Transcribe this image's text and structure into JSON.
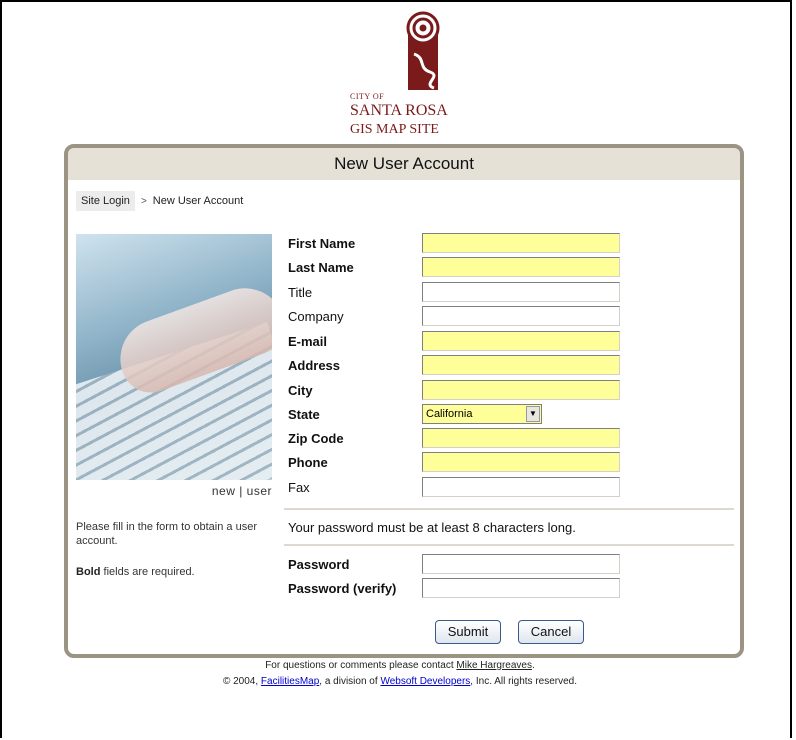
{
  "logo": {
    "city_of": "CITY OF",
    "city_name": "SANTA ROSA",
    "subtitle": "GIS MAP SITE"
  },
  "panel": {
    "title": "New User Account"
  },
  "breadcrumb": {
    "link": "Site Login",
    "separator": ">",
    "current": "New User Account"
  },
  "photo": {
    "caption": "new | user"
  },
  "info": {
    "instructions": "Please fill in the form to obtain a user account.",
    "required_bold": "Bold",
    "required_rest": " fields are required."
  },
  "form": {
    "fields": [
      {
        "label": "First Name",
        "required": true,
        "value": ""
      },
      {
        "label": "Last Name",
        "required": true,
        "value": ""
      },
      {
        "label": "Title",
        "required": false,
        "value": ""
      },
      {
        "label": "Company",
        "required": false,
        "value": ""
      },
      {
        "label": "E-mail",
        "required": true,
        "value": ""
      },
      {
        "label": "Address",
        "required": true,
        "value": ""
      },
      {
        "label": "City",
        "required": true,
        "value": ""
      },
      {
        "label": "State",
        "required": true,
        "value": "California"
      },
      {
        "label": "Zip Code",
        "required": true,
        "value": ""
      },
      {
        "label": "Phone",
        "required": true,
        "value": ""
      },
      {
        "label": "Fax",
        "required": false,
        "value": ""
      }
    ],
    "password_note": "Your password must be at least 8 characters long.",
    "password": {
      "label": "Password",
      "value": ""
    },
    "password_verify": {
      "label": "Password (verify)",
      "value": ""
    },
    "submit_label": "Submit",
    "cancel_label": "Cancel"
  },
  "footer": {
    "line1_prefix": "For questions or comments please contact ",
    "line1_contact": "Mike Hargreaves",
    "line1_suffix": ".",
    "line2_prefix": "© 2004, ",
    "line2_company": "FacilitiesMap",
    "line2_middle": ", a division of ",
    "line2_parent": "Websoft Developers",
    "line2_suffix": ", Inc. All rights reserved."
  },
  "colors": {
    "required_field": "#ffff99",
    "header_bg": "#e5e1d7",
    "panel_border": "#9b9484",
    "logo": "#7a1a1a"
  }
}
